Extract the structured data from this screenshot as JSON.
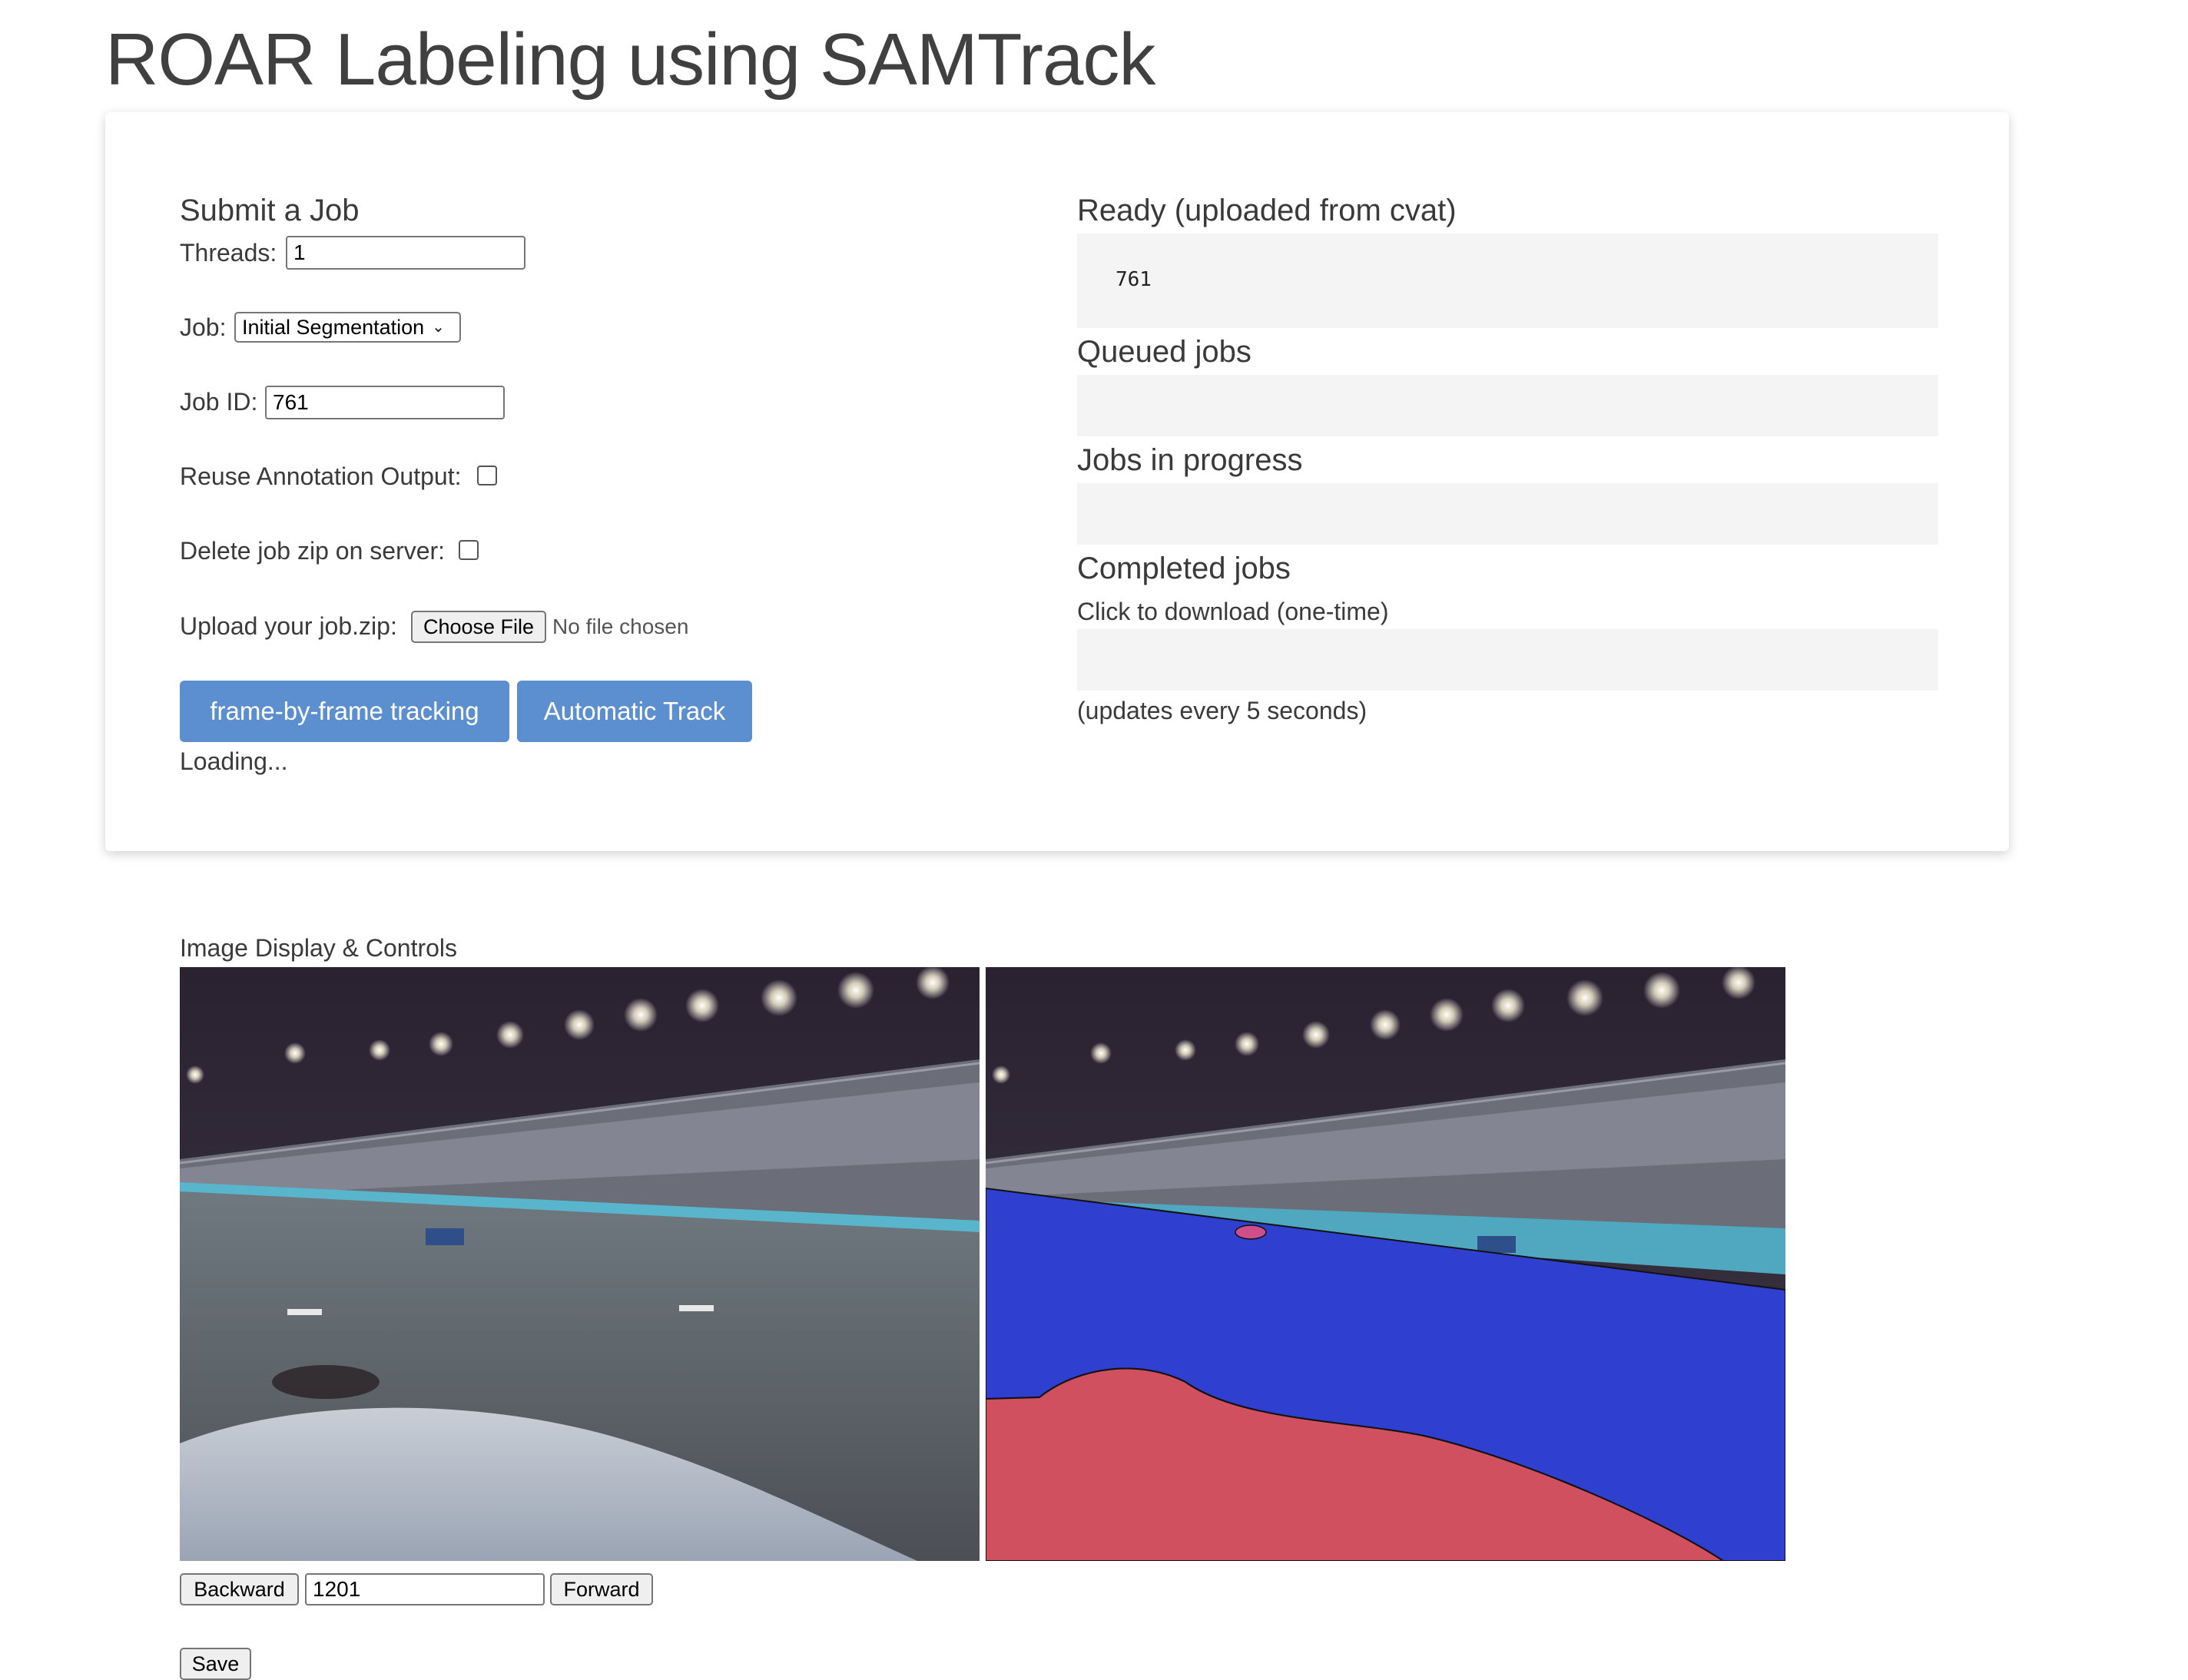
{
  "page": {
    "title": "ROAR Labeling using SAMTrack"
  },
  "submit": {
    "heading": "Submit a Job",
    "threads_label": "Threads:",
    "threads_value": "1",
    "job_label": "Job:",
    "job_selected": "Initial Segmentation",
    "job_id_label": "Job ID:",
    "job_id_value": "761",
    "reuse_label": "Reuse Annotation Output:",
    "reuse_checked": false,
    "delete_label": "Delete job zip on server:",
    "delete_checked": false,
    "upload_label": "Upload your job.zip:",
    "choose_file_label": "Choose File",
    "no_file_text": "No file chosen",
    "fbf_button": "frame-by-frame tracking",
    "auto_button": "Automatic Track",
    "loading_text": "Loading..."
  },
  "status": {
    "ready_heading": "Ready (uploaded from cvat)",
    "ready_items": [
      "761"
    ],
    "queued_heading": "Queued jobs",
    "progress_heading": "Jobs in progress",
    "completed_heading": "Completed jobs",
    "completed_hint": "Click to download (one-time)",
    "update_note": "(updates every 5 seconds)"
  },
  "display": {
    "heading": "Image Display & Controls",
    "backward_label": "Backward",
    "frame_value": "1201",
    "forward_label": "Forward",
    "save_label": "Save"
  },
  "colors": {
    "accent": "#5b8fd0",
    "mask_track": "#2f3fd0",
    "mask_car": "#d0505f"
  }
}
